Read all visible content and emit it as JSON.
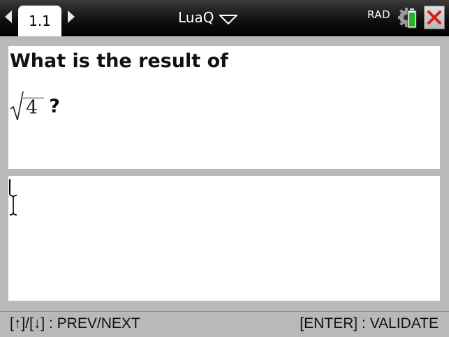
{
  "header": {
    "tab_label": "1.1",
    "document_title": "LuaQ",
    "angle_mode": "RAD",
    "icons": {
      "prev_page": "left-arrow-icon",
      "next_page": "right-arrow-icon",
      "title_menu": "chevron-down-icon",
      "battery": "battery-icon",
      "close": "close-icon"
    },
    "colors": {
      "close": "#d62020",
      "battery": "#22b422"
    }
  },
  "question": {
    "prompt": "What is the result of",
    "radicand": "4",
    "suffix": "?"
  },
  "answer": {
    "value": ""
  },
  "footer": {
    "hint_nav": "[↑]/[↓] : PREV/NEXT",
    "hint_validate": "[ENTER] : VALIDATE"
  }
}
